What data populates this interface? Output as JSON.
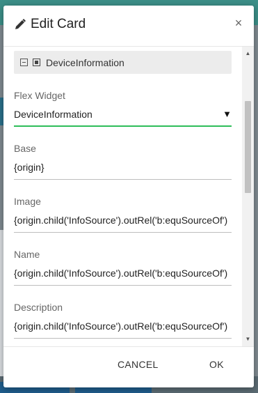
{
  "dialog": {
    "title": "Edit Card",
    "close_symbol": "×"
  },
  "tree": {
    "label": "DeviceInformation"
  },
  "fields": {
    "flex_widget": {
      "label": "Flex Widget",
      "value": "DeviceInformation"
    },
    "base": {
      "label": "Base",
      "value": "{origin}"
    },
    "image": {
      "label": "Image",
      "value": "{origin.child('InfoSource').outRel('b:equSourceOf')"
    },
    "name": {
      "label": "Name",
      "value": "{origin.child('InfoSource').outRel('b:equSourceOf')"
    },
    "description": {
      "label": "Description",
      "value": "{origin.child('InfoSource').outRel('b:equSourceOf')"
    }
  },
  "buttons": {
    "cancel": "CANCEL",
    "ok": "OK"
  },
  "colors": {
    "accent_green": "#2ebd59"
  },
  "icons": {
    "title": "pencil-icon",
    "close": "close-icon",
    "tree_collapse": "minus-box-icon",
    "tree_node": "chip-icon",
    "dropdown": "dropdown-arrow-icon"
  }
}
